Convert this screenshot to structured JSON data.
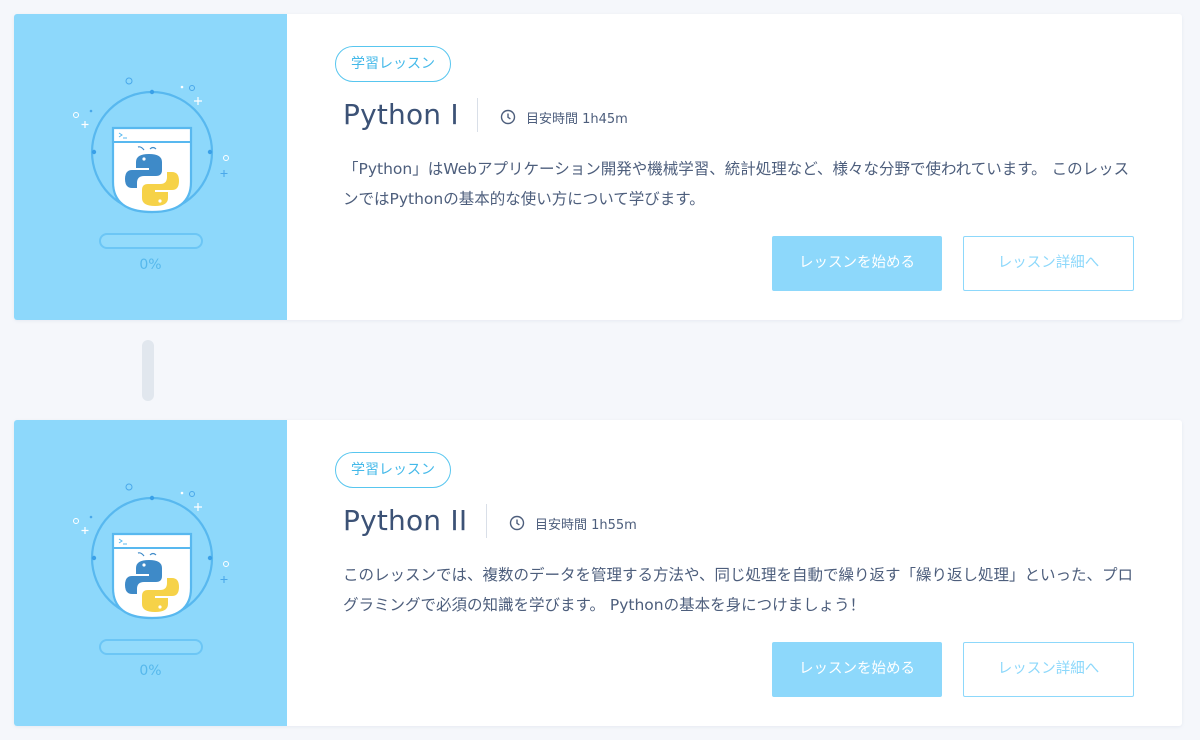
{
  "colors": {
    "background": "#f5f7fb",
    "visual_bg": "#8dd8fb",
    "accent": "#8dd8fb",
    "badge": "#44b9e9",
    "title": "#3c5276",
    "text": "#4d5e7c"
  },
  "lessons": [
    {
      "badge": "学習レッスン",
      "title": "Python I",
      "time": "目安時間 1h45m",
      "description": "「Python」はWebアプリケーション開発や機械学習、統計処理など、様々な分野で使われています。 このレッスンではPythonの基本的な使い方について学びます。",
      "progress_percent": 0,
      "progress_label": "0%",
      "start_button": "レッスンを始める",
      "detail_button": "レッスン詳細へ",
      "icons": [
        "python-logo-icon",
        "terminal-window-icon",
        "clock-icon"
      ]
    },
    {
      "badge": "学習レッスン",
      "title": "Python II",
      "time": "目安時間 1h55m",
      "description": "このレッスンでは、複数のデータを管理する方法や、同じ処理を自動で繰り返す「繰り返し処理」といった、プログラミングで必須の知識を学びます。 Pythonの基本を身につけましょう！",
      "progress_percent": 0,
      "progress_label": "0%",
      "start_button": "レッスンを始める",
      "detail_button": "レッスン詳細へ",
      "icons": [
        "python-logo-icon",
        "terminal-window-icon",
        "clock-icon"
      ]
    }
  ]
}
